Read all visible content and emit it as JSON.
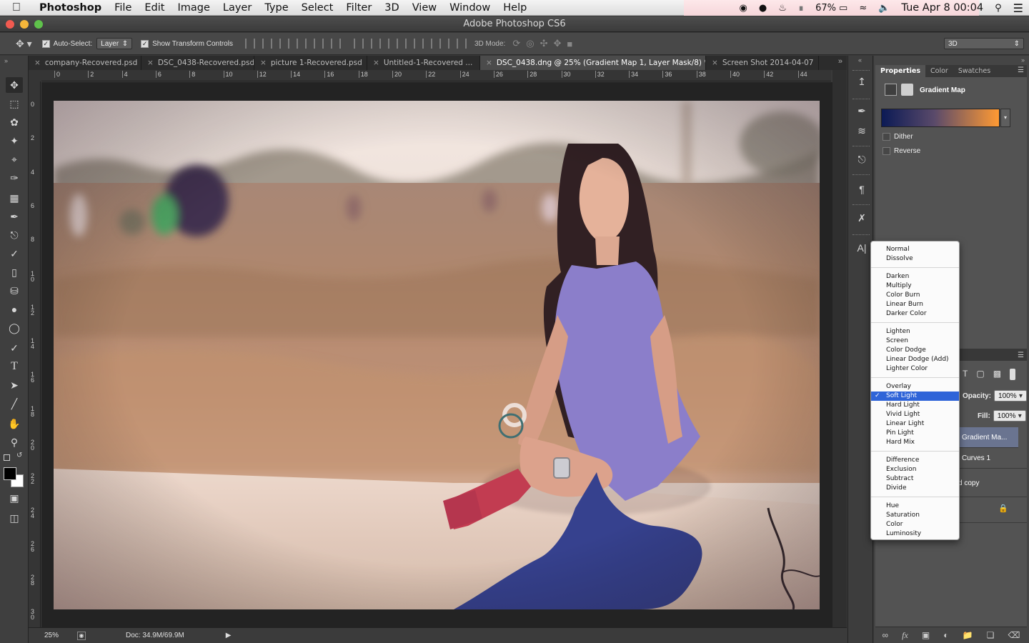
{
  "menubar": {
    "app": "Photoshop",
    "items": [
      "File",
      "Edit",
      "Image",
      "Layer",
      "Type",
      "Select",
      "Filter",
      "3D",
      "View",
      "Window",
      "Help"
    ],
    "battery": "67%",
    "clock": "Tue Apr 8  00:04"
  },
  "window": {
    "title": "Adobe Photoshop CS6"
  },
  "options": {
    "auto_select_label": "Auto-Select:",
    "auto_select_value": "Layer",
    "transform_label": "Show Transform Controls",
    "mode3d_label": "3D Mode:",
    "workspace": "3D"
  },
  "tabs": [
    "company-Recovered.psd",
    "DSC_0438-Recovered.psd",
    "picture 1-Recovered.psd",
    "Untitled-1-Recovered ...",
    "DSC_0438.dng @ 25% (Gradient Map 1, Layer Mask/8) *",
    "Screen Shot 2014-04-07"
  ],
  "ruler": {
    "h": [
      "0",
      "2",
      "4",
      "6",
      "8",
      "10",
      "12",
      "14",
      "16",
      "18",
      "20",
      "22",
      "24",
      "26",
      "28",
      "30",
      "32",
      "34",
      "36",
      "38",
      "40",
      "42",
      "44"
    ],
    "v": [
      "0",
      "2",
      "4",
      "6",
      "8",
      "10",
      "12",
      "14",
      "16",
      "18",
      "20",
      "22",
      "24",
      "26",
      "28",
      "30"
    ]
  },
  "status": {
    "zoom": "25%",
    "doc": "Doc: 34.9M/69.9M"
  },
  "properties": {
    "tabs": [
      "Properties",
      "Color",
      "Swatches"
    ],
    "title": "Gradient Map",
    "dither": "Dither",
    "reverse": "Reverse",
    "gradient_start": "#0b1a55",
    "gradient_end": "#ff9a33"
  },
  "layers": {
    "opacity_label": "Opacity:",
    "opacity": "100%",
    "fill_label": "Fill:",
    "fill": "100%",
    "rows": [
      "Gradient Ma...",
      "Curves 1",
      "d copy",
      "d"
    ]
  },
  "blend_modes": {
    "selected": "Soft Light",
    "checkmark": "✓",
    "groups": [
      [
        "Normal",
        "Dissolve"
      ],
      [
        "Darken",
        "Multiply",
        "Color Burn",
        "Linear Burn",
        "Darker Color"
      ],
      [
        "Lighten",
        "Screen",
        "Color Dodge",
        "Linear Dodge (Add)",
        "Lighter Color"
      ],
      [
        "Overlay",
        "Soft Light",
        "Hard Light",
        "Vivid Light",
        "Linear Light",
        "Pin Light",
        "Hard Mix"
      ],
      [
        "Difference",
        "Exclusion",
        "Subtract",
        "Divide"
      ],
      [
        "Hue",
        "Saturation",
        "Color",
        "Luminosity"
      ]
    ]
  }
}
